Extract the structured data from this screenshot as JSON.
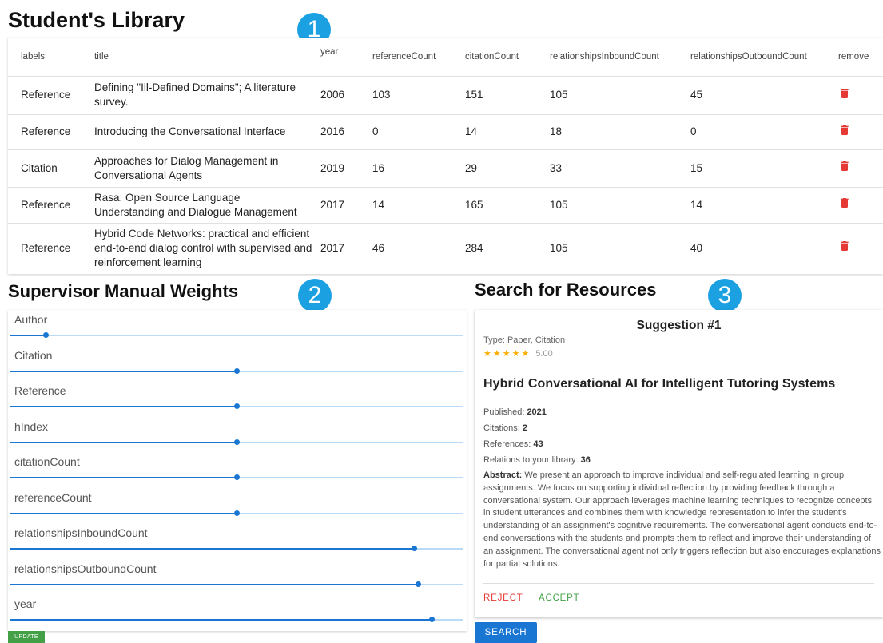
{
  "library": {
    "title": "Student's Library",
    "columns": [
      "labels",
      "title",
      "year",
      "referenceCount",
      "citationCount",
      "relationshipsInboundCount",
      "relationshipsOutboundCount",
      "remove"
    ],
    "rows": [
      {
        "labels": "Reference",
        "title": "Defining \"Ill-Defined Domains\"; A literature survey.",
        "year": "2006",
        "referenceCount": "103",
        "citationCount": "151",
        "relationshipsInboundCount": "105",
        "relationshipsOutboundCount": "45"
      },
      {
        "labels": "Reference",
        "title": "Introducing the Conversational Interface",
        "year": "2016",
        "referenceCount": "0",
        "citationCount": "14",
        "relationshipsInboundCount": "18",
        "relationshipsOutboundCount": "0"
      },
      {
        "labels": "Citation",
        "title": "Approaches for Dialog Management in Conversational Agents",
        "year": "2019",
        "referenceCount": "16",
        "citationCount": "29",
        "relationshipsInboundCount": "33",
        "relationshipsOutboundCount": "15"
      },
      {
        "labels": "Reference",
        "title": "Rasa: Open Source Language Understanding and Dialogue Management",
        "year": "2017",
        "referenceCount": "14",
        "citationCount": "165",
        "relationshipsInboundCount": "105",
        "relationshipsOutboundCount": "14"
      },
      {
        "labels": "Reference",
        "title": "Hybrid Code Networks: practical and efficient end-to-end dialog control with supervised and reinforcement learning",
        "year": "2017",
        "referenceCount": "46",
        "citationCount": "284",
        "relationshipsInboundCount": "105",
        "relationshipsOutboundCount": "40"
      }
    ],
    "remove_icon": "trash-icon"
  },
  "markers": [
    "1",
    "2",
    "3"
  ],
  "weights": {
    "title": "Supervisor Manual Weights",
    "items": [
      {
        "label": "Author",
        "value": 0.08
      },
      {
        "label": "Citation",
        "value": 0.5
      },
      {
        "label": "Reference",
        "value": 0.5
      },
      {
        "label": "hIndex",
        "value": 0.5
      },
      {
        "label": "citationCount",
        "value": 0.5
      },
      {
        "label": "referenceCount",
        "value": 0.5
      },
      {
        "label": "relationshipsInboundCount",
        "value": 0.89
      },
      {
        "label": "relationshipsOutboundCount",
        "value": 0.9
      },
      {
        "label": "year",
        "value": 0.93
      }
    ],
    "update_label": "UPDATE",
    "colors": {
      "accent": "#1976d2",
      "track": "#b9dbf7",
      "update": "#43a047"
    }
  },
  "search": {
    "title": "Search for Resources",
    "suggestion": {
      "heading": "Suggestion #1",
      "type": "Type: Paper, Citation",
      "stars": "★★★★★",
      "rating": "5.00",
      "paper_title": "Hybrid Conversational AI for Intelligent Tutoring Systems",
      "published_label": "Published:",
      "published": "2021",
      "citations_label": "Citations:",
      "citations": "2",
      "references_label": "References:",
      "references": "43",
      "relations_label": "Relations to your library:",
      "relations": "36",
      "abstract_label": "Abstract:",
      "abstract": "We present an approach to improve individual and self-regulated learning in group assignments. We focus on supporting individual reflection by providing feedback through a conversational system. Our approach leverages machine learning techniques to recognize concepts in student utterances and combines them with knowledge representation to infer the student's understanding of an assignment's cognitive requirements. The conversational agent conducts end-to-end conversations with the students and prompts them to reflect and improve their understanding of an assignment. The conversational agent not only triggers reflection but also encourages explanations for partial solutions.",
      "reject_label": "REJECT",
      "accept_label": "ACCEPT"
    },
    "search_label": "SEARCH",
    "colors": {
      "reject": "#e53935",
      "accept": "#43a047",
      "stars": "#faaf00",
      "button": "#1976d2"
    }
  }
}
